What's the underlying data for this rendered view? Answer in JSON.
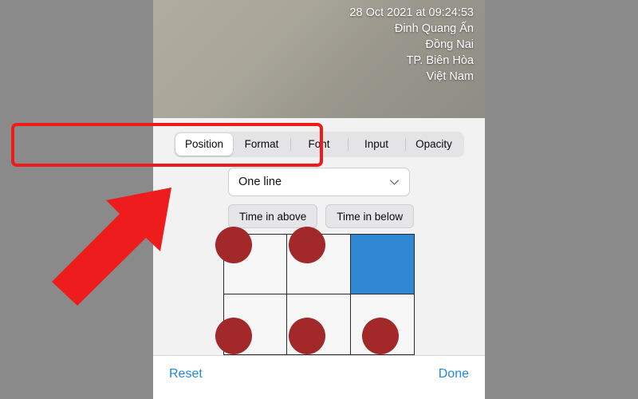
{
  "photo": {
    "stamp_lines": [
      "28 Oct 2021 at 09:24:53",
      "Đinh Quang Ấn",
      "Đồng Nai",
      "TP. Biên Hòa",
      "Việt Nam"
    ]
  },
  "tabs": [
    {
      "label": "Position",
      "active": true
    },
    {
      "label": "Format",
      "active": false
    },
    {
      "label": "Font",
      "active": false
    },
    {
      "label": "Input",
      "active": false
    },
    {
      "label": "Opacity",
      "active": false
    }
  ],
  "dropdown": {
    "value": "One line",
    "icon": "chevron-down-icon"
  },
  "time_buttons": [
    {
      "label": "Time in above"
    },
    {
      "label": "Time in below"
    }
  ],
  "position_grid": {
    "rows": 2,
    "cols": 3,
    "selected_index": 3,
    "selected_color": "#2f86d1"
  },
  "bottom_bar": {
    "reset_label": "Reset",
    "done_label": "Done",
    "link_color": "#1e8ae0"
  },
  "annotations": {
    "highlight_color": "#ef1b1b",
    "arrow_color": "#ee1c1c"
  }
}
